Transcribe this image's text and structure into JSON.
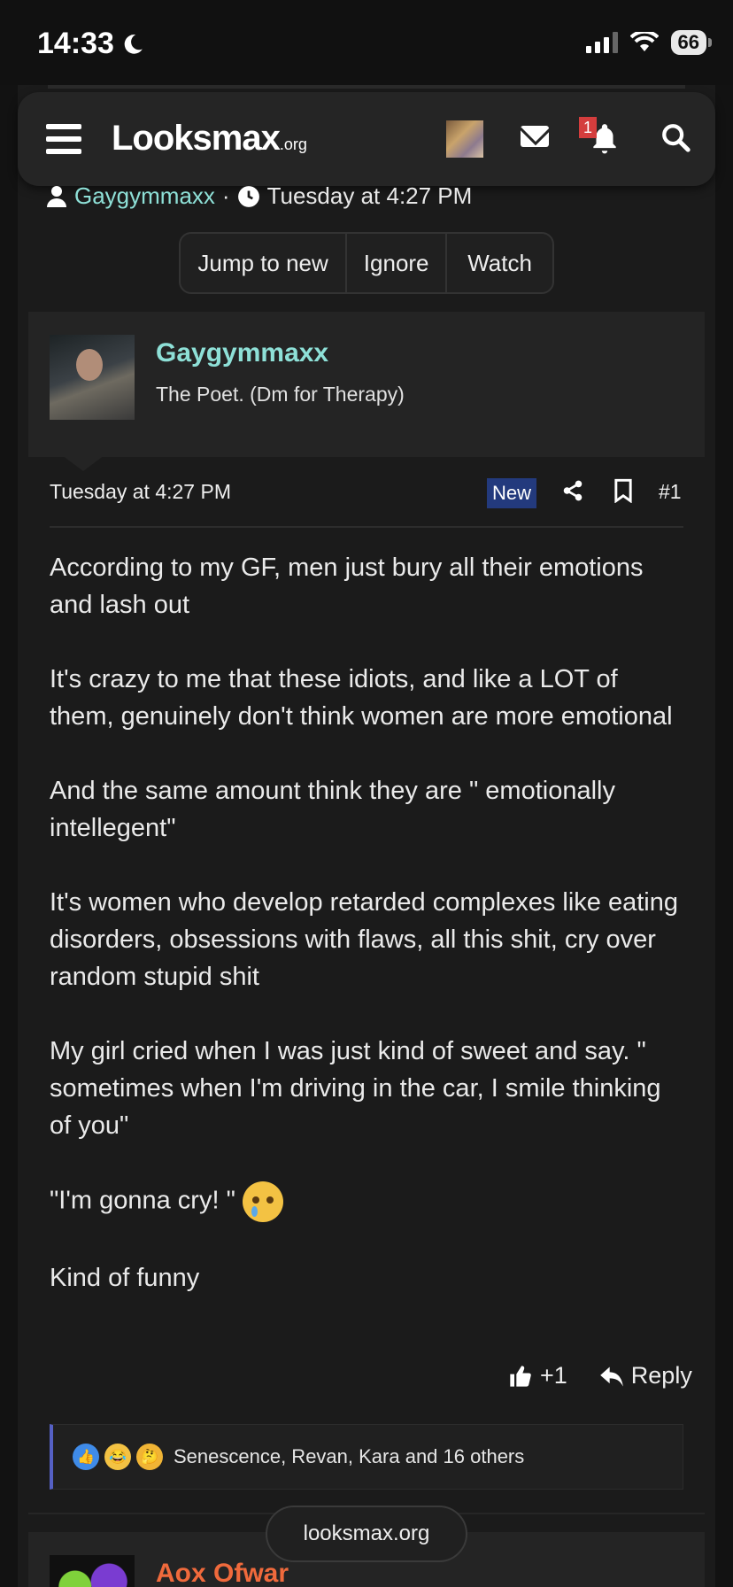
{
  "status_bar": {
    "time": "14:33",
    "battery": "66"
  },
  "header": {
    "logo_main": "Looksmax",
    "logo_suffix": ".org",
    "notification_count": "1"
  },
  "thread": {
    "author": "Gaygymmaxx",
    "separator": "·",
    "date": "Tuesday at 4:27 PM",
    "buttons": [
      "Jump to new",
      "Ignore",
      "Watch"
    ]
  },
  "post": {
    "username": "Gaygymmaxx",
    "user_title": "The Poet. (Dm for Therapy)",
    "date": "Tuesday at 4:27 PM",
    "new_label": "New",
    "number": "#1",
    "paragraphs": [
      "According to my GF, men just bury all their emotions and lash out",
      "It's crazy to me that these idiots, and like a LOT of them, genuinely don't think women are more emotional",
      "And the same amount think they are \" emotionally intellegent\"",
      "It's women who develop retarded complexes like eating disorders, obsessions with flaws, all this shit, cry over random stupid shit",
      "My girl cried when I was just kind of sweet and say. \" sometimes when I'm driving in the car, I smile thinking of you\"",
      "\"I'm gonna cry! \"",
      "Kind of funny"
    ],
    "like_label": "+1",
    "reply_label": "Reply",
    "reactions_text": "Senescence, Revan, Kara and 16 others"
  },
  "next_post": {
    "username": "Aox Ofwar"
  },
  "floating_label": "looksmax.org",
  "colors": {
    "username": "#8ee0d7",
    "new_tag": "#233a7d",
    "reaction_bar": "#5560c4",
    "next_username": "#f06a3c"
  }
}
